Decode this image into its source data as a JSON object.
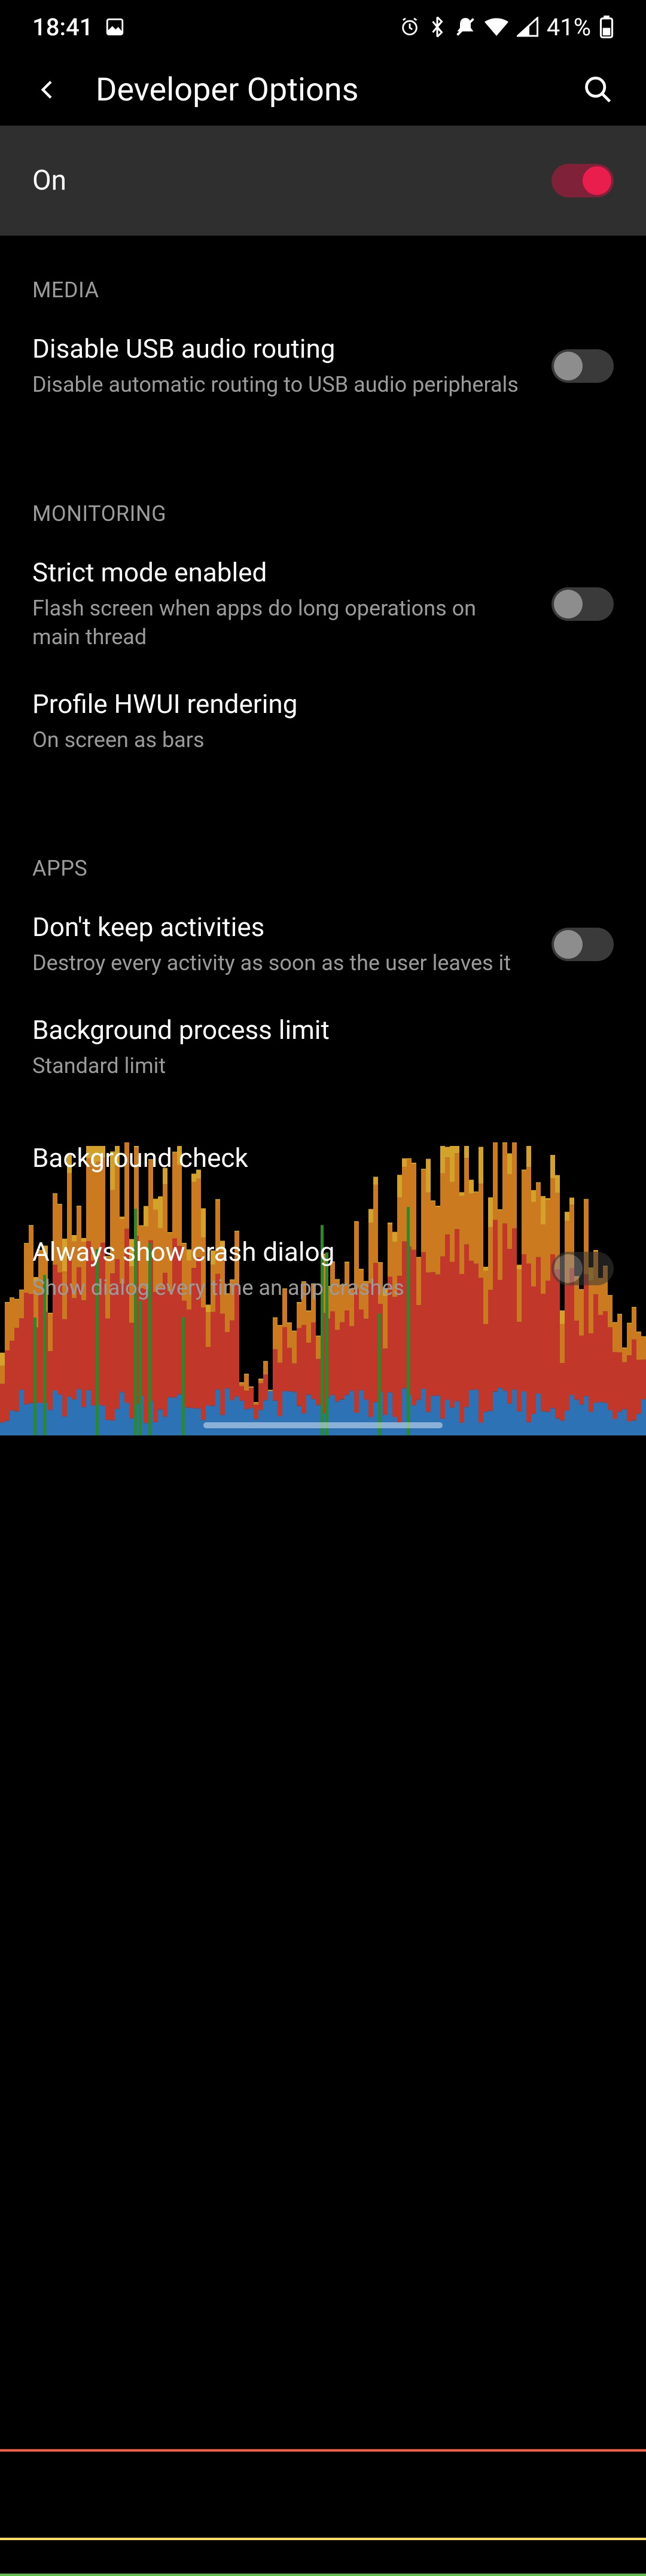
{
  "status_bar": {
    "time": "18:41",
    "battery_pct": "41%"
  },
  "app_bar": {
    "title": "Developer Options"
  },
  "master": {
    "label": "On",
    "enabled": true
  },
  "sections": {
    "media": {
      "header": "MEDIA"
    },
    "monitoring": {
      "header": "MONITORING"
    },
    "apps": {
      "header": "APPS"
    }
  },
  "settings": {
    "disable_usb_audio": {
      "title": "Disable USB audio routing",
      "sub": "Disable automatic routing to USB audio peripherals",
      "value": false
    },
    "strict_mode": {
      "title": "Strict mode enabled",
      "sub": "Flash screen when apps do long operations on main thread",
      "value": false
    },
    "profile_hwui": {
      "title": "Profile HWUI rendering",
      "sub": "On screen as bars"
    },
    "dont_keep_activities": {
      "title": "Don't keep activities",
      "sub": "Destroy every activity as soon as the user leaves it",
      "value": false
    },
    "bg_process_limit": {
      "title": "Background process limit",
      "sub": "Standard limit"
    },
    "background_check": {
      "title": "Background check"
    },
    "always_show_crash": {
      "title": "Always show crash dialog",
      "sub": "Show dialog every time an app crashes",
      "value": false
    }
  }
}
